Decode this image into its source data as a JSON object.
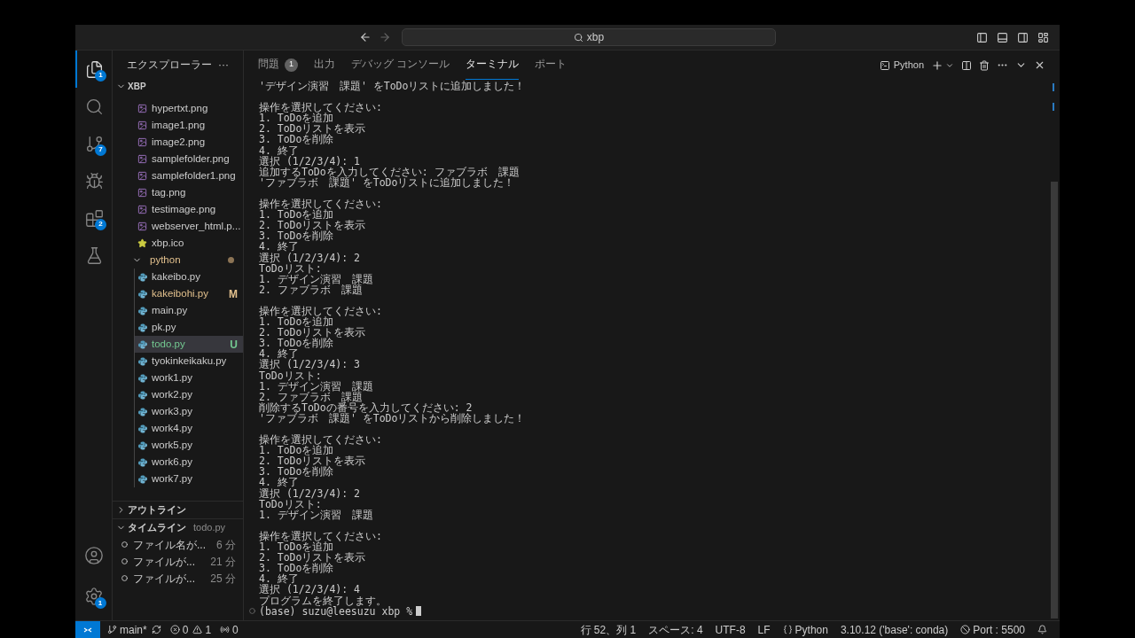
{
  "title_bar": {
    "search": "xbp"
  },
  "activity_bar": [
    {
      "kind": "explorer",
      "selected": true,
      "badge": "1"
    },
    {
      "kind": "search",
      "selected": false
    },
    {
      "kind": "source_control",
      "selected": false,
      "badge": "7"
    },
    {
      "kind": "run_debug",
      "selected": false
    },
    {
      "kind": "extensions",
      "selected": false,
      "badge": "2"
    },
    {
      "kind": "testing",
      "selected": false
    }
  ],
  "activity_bar_bottom": [
    {
      "kind": "account"
    },
    {
      "kind": "settings",
      "badge": "1"
    }
  ],
  "sidebar": {
    "title": "エクスプローラー",
    "more": "···",
    "root": {
      "label": "XBP",
      "expanded": true,
      "children": [
        {
          "label": "hypertxt.png",
          "kind": "image",
          "selected": false
        },
        {
          "label": "image1.png",
          "kind": "image",
          "selected": false
        },
        {
          "label": "image2.png",
          "kind": "image",
          "selected": false
        },
        {
          "label": "samplefolder.png",
          "kind": "image",
          "selected": false
        },
        {
          "label": "samplefolder1.png",
          "kind": "image",
          "selected": false
        },
        {
          "label": "tag.png",
          "kind": "image",
          "selected": false
        },
        {
          "label": "testimage.png",
          "kind": "image",
          "selected": false
        },
        {
          "label": "webserver_html.p...",
          "kind": "image",
          "selected": false
        },
        {
          "label": "xbp.ico",
          "kind": "star",
          "selected": false
        },
        {
          "label": "python",
          "kind": "folder",
          "expanded": true,
          "modified_dot": true,
          "selected": false,
          "children": [
            {
              "label": "kakeibo.py",
              "kind": "python",
              "selected": false
            },
            {
              "label": "kakeibohi.py",
              "kind": "python",
              "status": "M",
              "color": "#e2c08d",
              "selected": false
            },
            {
              "label": "main.py",
              "kind": "python",
              "selected": false
            },
            {
              "label": "pk.py",
              "kind": "python",
              "selected": false
            },
            {
              "label": "todo.py",
              "kind": "python",
              "status": "U",
              "color": "#73c991",
              "selected": true
            },
            {
              "label": "tyokinkeikaku.py",
              "kind": "python",
              "selected": false
            },
            {
              "label": "work1.py",
              "kind": "python",
              "selected": false
            },
            {
              "label": "work2.py",
              "kind": "python",
              "selected": false
            },
            {
              "label": "work3.py",
              "kind": "python",
              "selected": false
            },
            {
              "label": "work4.py",
              "kind": "python",
              "selected": false
            },
            {
              "label": "work5.py",
              "kind": "python",
              "selected": false
            },
            {
              "label": "work6.py",
              "kind": "python",
              "selected": false
            },
            {
              "label": "work7.py",
              "kind": "python",
              "selected": false
            }
          ]
        }
      ]
    }
  },
  "outline": {
    "title": "アウトライン",
    "expanded": false
  },
  "timeline": {
    "title": "タイムライン",
    "file": "todo.py",
    "expanded": true,
    "items": [
      {
        "label": "ファイル名が...",
        "time": "6 分"
      },
      {
        "label": "ファイルが...",
        "time": "21 分"
      },
      {
        "label": "ファイルが...",
        "time": "25 分"
      }
    ]
  },
  "panel": {
    "tabs": [
      {
        "label": "問題",
        "badge": "1",
        "selected": false
      },
      {
        "label": "出力",
        "selected": false
      },
      {
        "label": "デバッグ コンソール",
        "selected": false
      },
      {
        "label": "ターミナル",
        "selected": true
      },
      {
        "label": "ポート",
        "selected": false
      }
    ],
    "terminal_name": "Python"
  },
  "terminal": {
    "lines": [
      {
        "text": "'デザイン演習　課題' をToDoリストに追加しました！"
      },
      {
        "text": "操作を選択してください:",
        "gap_before": true
      },
      {
        "text": "1. ToDoを追加"
      },
      {
        "text": "2. ToDoリストを表示"
      },
      {
        "text": "3. ToDoを削除"
      },
      {
        "text": "4. 終了"
      },
      {
        "text": "選択 (1/2/3/4): 1"
      },
      {
        "text": "追加するToDoを入力してください: ファブラボ　課題"
      },
      {
        "text": "'ファブラボ　課題' をToDoリストに追加しました！"
      },
      {
        "text": "操作を選択してください:",
        "gap_before": true
      },
      {
        "text": "1. ToDoを追加"
      },
      {
        "text": "2. ToDoリストを表示"
      },
      {
        "text": "3. ToDoを削除"
      },
      {
        "text": "4. 終了"
      },
      {
        "text": "選択 (1/2/3/4): 2"
      },
      {
        "text": "ToDoリスト:"
      },
      {
        "text": "1. デザイン演習　課題"
      },
      {
        "text": "2. ファブラボ　課題"
      },
      {
        "text": "操作を選択してください:",
        "gap_before": true
      },
      {
        "text": "1. ToDoを追加"
      },
      {
        "text": "2. ToDoリストを表示"
      },
      {
        "text": "3. ToDoを削除"
      },
      {
        "text": "4. 終了"
      },
      {
        "text": "選択 (1/2/3/4): 3"
      },
      {
        "text": "ToDoリスト:"
      },
      {
        "text": "1. デザイン演習　課題"
      },
      {
        "text": "2. ファブラボ　課題"
      },
      {
        "text": "削除するToDoの番号を入力してください: 2"
      },
      {
        "text": "'ファブラボ　課題' をToDoリストから削除しました！"
      },
      {
        "text": "操作を選択してください:",
        "gap_before": true
      },
      {
        "text": "1. ToDoを追加"
      },
      {
        "text": "2. ToDoリストを表示"
      },
      {
        "text": "3. ToDoを削除"
      },
      {
        "text": "4. 終了"
      },
      {
        "text": "選択 (1/2/3/4): 2"
      },
      {
        "text": "ToDoリスト:"
      },
      {
        "text": "1. デザイン演習　課題"
      },
      {
        "text": "操作を選択してください:",
        "gap_before": true
      },
      {
        "text": "1. ToDoを追加"
      },
      {
        "text": "2. ToDoリストを表示"
      },
      {
        "text": "3. ToDoを削除"
      },
      {
        "text": "4. 終了"
      },
      {
        "text": "選択 (1/2/3/4): 4"
      },
      {
        "text": "プログラムを終了します。"
      }
    ],
    "prompt": "(base) suzu@leesuzu xbp %"
  },
  "status_bar": {
    "branch": "main*",
    "errors": "0",
    "warnings": "1",
    "ports": "0",
    "right": [
      {
        "kind": "text",
        "label": "行 52、列 1"
      },
      {
        "kind": "text",
        "label": "スペース: 4"
      },
      {
        "kind": "text",
        "label": "UTF-8"
      },
      {
        "kind": "text",
        "label": "LF"
      },
      {
        "kind": "language",
        "label": "Python"
      },
      {
        "kind": "text",
        "label": "3.10.12 ('base': conda)"
      },
      {
        "kind": "port",
        "label": "Port : 5500"
      },
      {
        "kind": "bell"
      }
    ]
  }
}
